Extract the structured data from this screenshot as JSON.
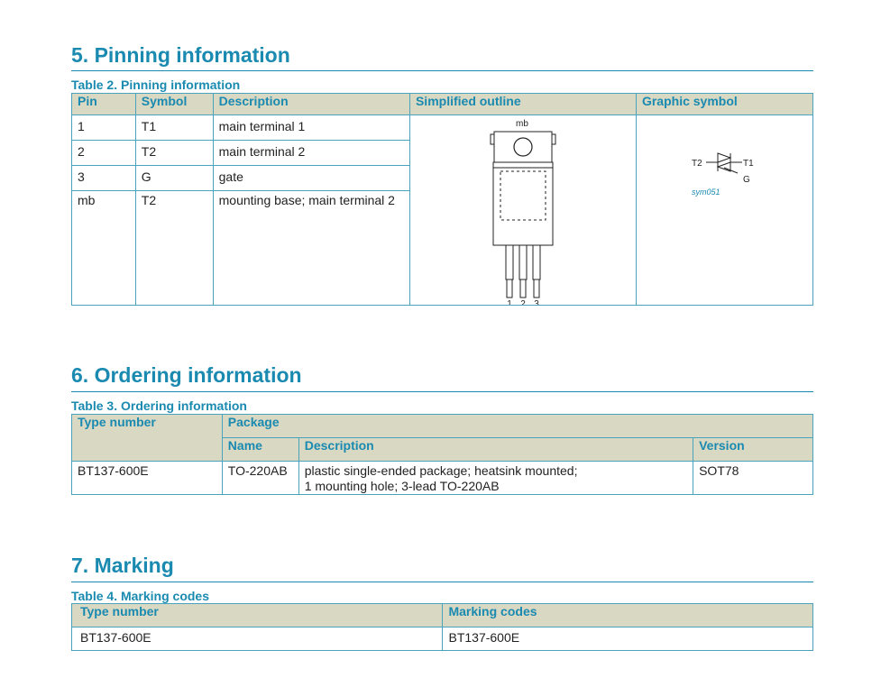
{
  "sec5": {
    "title": "5. Pinning information",
    "table_caption": "Table 2. Pinning information",
    "headers": [
      "Pin",
      "Symbol",
      "Description",
      "Simplified outline",
      "Graphic symbol"
    ],
    "rows": [
      {
        "pin": "1",
        "symbol": "T1",
        "description": "main terminal 1"
      },
      {
        "pin": "2",
        "symbol": "T2",
        "description": "main terminal 2"
      },
      {
        "pin": "3",
        "symbol": "G",
        "description": "gate"
      },
      {
        "pin": "mb",
        "symbol": "T2",
        "description": "mounting base; main terminal 2"
      }
    ],
    "outline": {
      "mb_label": "mb",
      "pin_labels": [
        "1",
        "2",
        "3"
      ]
    },
    "symbol": {
      "t2": "T2",
      "t1": "T1",
      "g": "G",
      "ref": "sym051"
    }
  },
  "sec6": {
    "title": "6. Ordering information",
    "table_caption": "Table 3. Ordering information",
    "headers": {
      "type_number": "Type number",
      "package": "Package",
      "name": "Name",
      "description": "Description",
      "version": "Version"
    },
    "row": {
      "type_number": "BT137-600E",
      "name": "TO-220AB",
      "description_line1": "plastic single-ended package; heatsink mounted;",
      "description_line2": "1 mounting hole; 3-lead TO-220AB",
      "version": "SOT78"
    }
  },
  "sec7": {
    "title": "7. Marking",
    "table_caption": "Table 4. Marking codes",
    "headers": {
      "type_number": "Type number",
      "marking_codes": "Marking codes"
    },
    "row": {
      "type_number": "BT137-600E",
      "marking_codes": "BT137-600E"
    }
  },
  "colors": {
    "accent": "#1a8ab0",
    "header_bg": "#d9d8c3",
    "border": "#4aa3bd"
  }
}
